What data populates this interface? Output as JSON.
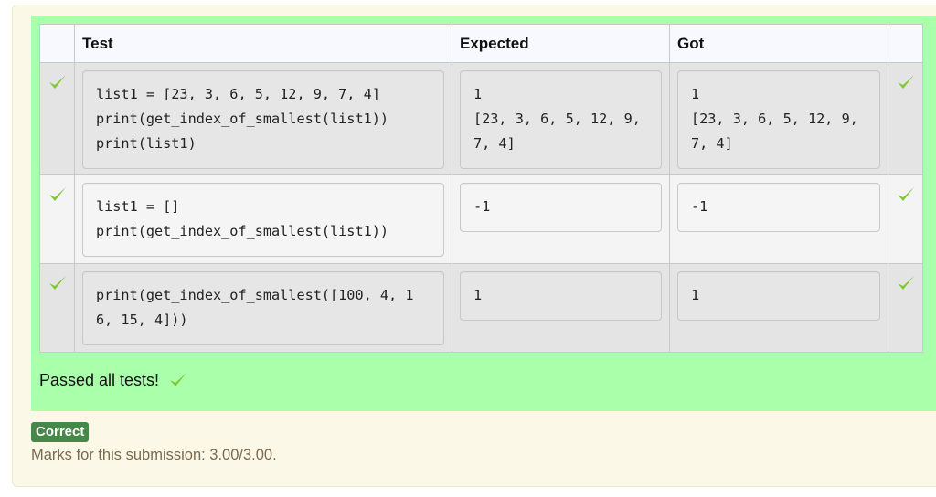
{
  "colors": {
    "result_bg": "#aaffaa",
    "outcome_bg": "#fcf8e8",
    "correct_badge": "#468847",
    "tick": "#7fc832"
  },
  "table": {
    "headers": [
      "",
      "Test",
      "Expected",
      "Got",
      ""
    ],
    "rows": [
      {
        "status_icon": "check-icon",
        "test": "list1 = [23, 3, 6, 5, 12, 9, 7, 4]\nprint(get_index_of_smallest(list1))\nprint(list1)",
        "expected": "1\n[23, 3, 6, 5, 12, 9,\n7, 4]",
        "got": "1\n[23, 3, 6, 5, 12, 9,\n7, 4]"
      },
      {
        "status_icon": "check-icon",
        "test": "list1 = []\nprint(get_index_of_smallest(list1))",
        "expected": "-1",
        "got": "-1"
      },
      {
        "status_icon": "check-icon",
        "test": "print(get_index_of_smallest([100, 4, 1\n6, 15, 4]))",
        "expected": "1",
        "got": "1"
      }
    ]
  },
  "summary": {
    "passed_text": "Passed all tests!",
    "badge": "Correct",
    "marks": "Marks for this submission: 3.00/3.00."
  }
}
